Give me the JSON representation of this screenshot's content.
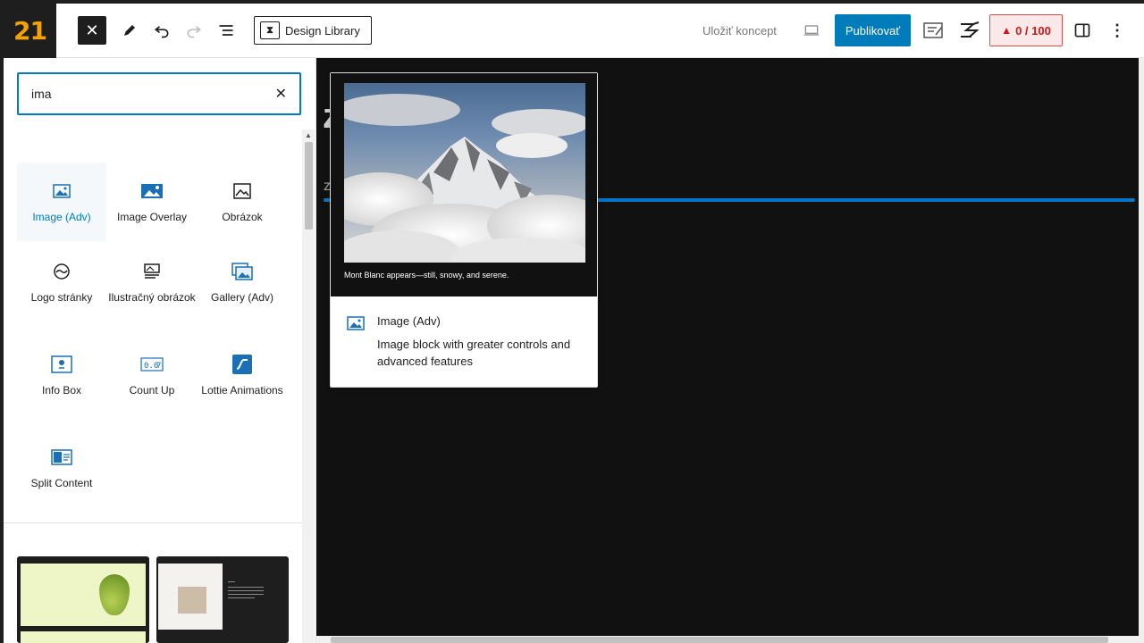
{
  "header": {
    "logo_text": "21",
    "design_library_label": "Design Library",
    "save_draft_label": "Uložiť koncept",
    "publish_label": "Publikovať",
    "score_label": "0 / 100"
  },
  "inserter": {
    "search_value": "ima",
    "blocks": [
      {
        "label": "Image (Adv)",
        "icon": "image-icon",
        "active": true
      },
      {
        "label": "Image Overlay",
        "icon": "image-overlay-icon"
      },
      {
        "label": "Obrázok",
        "icon": "image-icon"
      },
      {
        "label": "Logo stránky",
        "icon": "site-logo-icon"
      },
      {
        "label": "Ilustračný obrázok",
        "icon": "featured-image-icon"
      },
      {
        "label": "Gallery (Adv)",
        "icon": "gallery-icon"
      },
      {
        "label": "Info Box",
        "icon": "info-box-icon"
      },
      {
        "label": "Count Up",
        "icon": "count-up-icon"
      },
      {
        "label": "Lottie Animations",
        "icon": "lottie-icon"
      },
      {
        "label": "Split Content",
        "icon": "split-content-icon"
      }
    ]
  },
  "preview": {
    "caption": "Mont Blanc appears—still, snowy, and serene.",
    "title": "Image (Adv)",
    "description": "Image block with greater controls and advanced features"
  },
  "colors": {
    "accent": "#007cba",
    "canvas_bg": "#111111",
    "score_red": "#cc1818",
    "logo_orange": "#f5a200"
  }
}
